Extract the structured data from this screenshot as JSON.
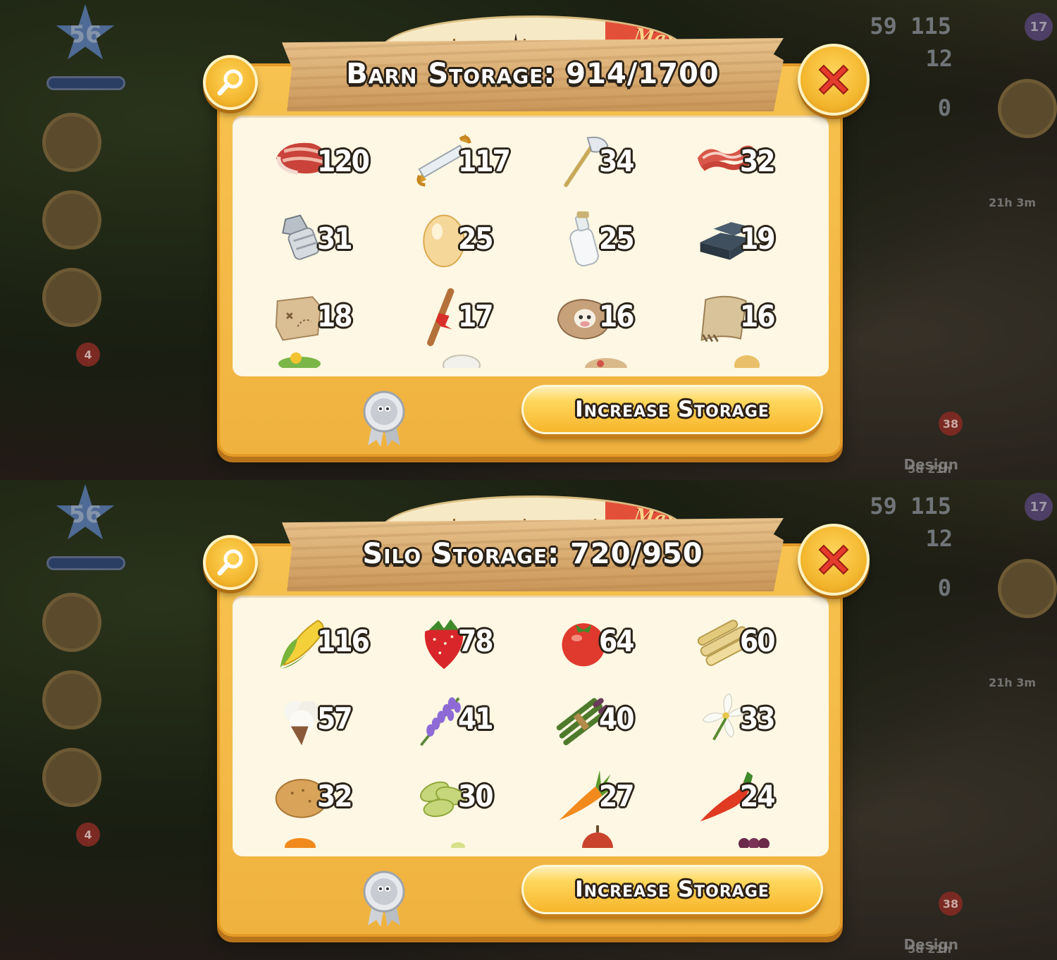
{
  "hud": {
    "level": "56",
    "coins": "59 115",
    "gems": "12",
    "vouchers": "0",
    "notifications": "17",
    "badge_left": "4",
    "badge_right": "38",
    "design_label": "Design",
    "design_timer": "5d 21h",
    "timer": "21h 3m"
  },
  "gauge": {
    "max_label": "Max"
  },
  "barn": {
    "title": "Barn Storage: 914/1700",
    "fill_fraction": 0.54,
    "items": [
      {
        "icon": "fish-fillet-icon",
        "qty": "120"
      },
      {
        "icon": "saw-icon",
        "qty": "117"
      },
      {
        "icon": "axe-icon",
        "qty": "34"
      },
      {
        "icon": "bacon-icon",
        "qty": "32"
      },
      {
        "icon": "bolt-icon",
        "qty": "31"
      },
      {
        "icon": "egg-icon",
        "qty": "25"
      },
      {
        "icon": "milk-bottle-icon",
        "qty": "25"
      },
      {
        "icon": "tar-bars-icon",
        "qty": "19"
      },
      {
        "icon": "map-piece-icon",
        "qty": "18"
      },
      {
        "icon": "wooden-stake-icon",
        "qty": "17"
      },
      {
        "icon": "cow-feed-sack-icon",
        "qty": "16"
      },
      {
        "icon": "deed-scroll-icon",
        "qty": "16"
      }
    ],
    "button_label": "Increase Storage"
  },
  "silo": {
    "title": "Silo Storage: 720/950",
    "fill_fraction": 0.76,
    "items": [
      {
        "icon": "corn-icon",
        "qty": "116"
      },
      {
        "icon": "strawberry-icon",
        "qty": "78"
      },
      {
        "icon": "tomato-icon",
        "qty": "64"
      },
      {
        "icon": "sugarcane-icon",
        "qty": "60"
      },
      {
        "icon": "cotton-icon",
        "qty": "57"
      },
      {
        "icon": "lavender-icon",
        "qty": "41"
      },
      {
        "icon": "asparagus-icon",
        "qty": "40"
      },
      {
        "icon": "lily-icon",
        "qty": "33"
      },
      {
        "icon": "potato-icon",
        "qty": "32"
      },
      {
        "icon": "soybean-icon",
        "qty": "30"
      },
      {
        "icon": "carrot-icon",
        "qty": "27"
      },
      {
        "icon": "chili-pepper-icon",
        "qty": "24"
      }
    ],
    "button_label": "Increase Storage"
  }
}
